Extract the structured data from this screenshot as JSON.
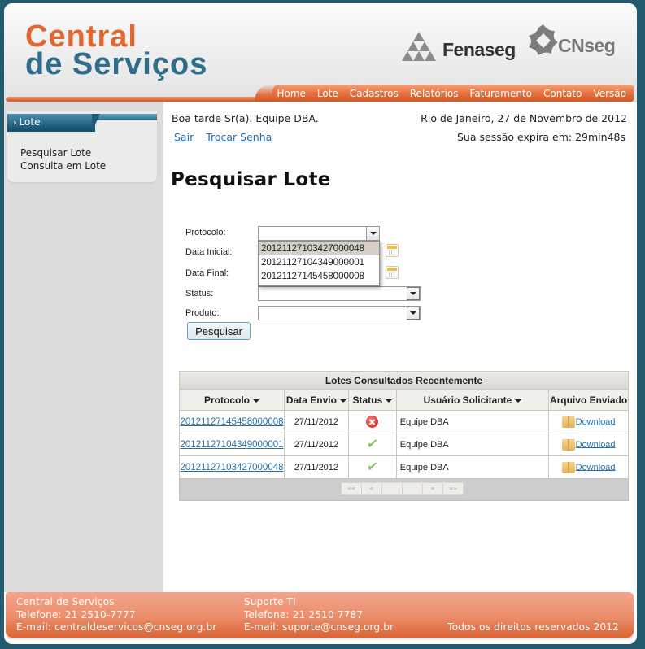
{
  "header": {
    "logo_line1": "Central",
    "logo_line2": "de Serviços",
    "partner1": "Fenaseg",
    "partner2": "CNseg",
    "nav": [
      "Home",
      "Lote",
      "Cadastros",
      "Relatórios",
      "Faturamento",
      "Contato",
      "Versão"
    ]
  },
  "sidebar": {
    "section_title": "Lote",
    "items": [
      "Pesquisar Lote",
      "Consulta em Lote"
    ]
  },
  "user": {
    "greeting": "Boa tarde Sr(a). Equipe DBA.",
    "date": "Rio de Janeiro, 27 de Novembro de 2012",
    "logout": "Sair",
    "change_password": "Trocar Senha",
    "session": "Sua sessão expira em: 29min48s"
  },
  "page": {
    "title": "Pesquisar Lote"
  },
  "form": {
    "protocolo_label": "Protocolo:",
    "protocolo_value": "",
    "protocolo_options": [
      "20121127103427000048",
      "20121127104349000001",
      "20121127145458000008"
    ],
    "data_inicial_label": "Data Inicial:",
    "data_final_label": "Data Final:",
    "status_label": "Status:",
    "status_value": "",
    "produto_label": "Produto:",
    "produto_value": "",
    "search_button": "Pesquisar"
  },
  "table": {
    "title": "Lotes Consultados Recentemente",
    "columns": [
      "Protocolo",
      "Data Envio",
      "Status",
      "Usuário Solicitante",
      "Arquivo Enviado"
    ],
    "rows": [
      {
        "protocolo": "20121127145458000008",
        "data_envio": "27/11/2012",
        "status": "error",
        "usuario": "Equipe DBA",
        "arquivo": "Download"
      },
      {
        "protocolo": "20121127104349000001",
        "data_envio": "27/11/2012",
        "status": "success",
        "usuario": "Equipe DBA",
        "arquivo": "Download"
      },
      {
        "protocolo": "20121127103427000048",
        "data_envio": "27/11/2012",
        "status": "success",
        "usuario": "Equipe DBA",
        "arquivo": "Download"
      }
    ],
    "pager": [
      "««",
      "«",
      "",
      "",
      "»",
      "»»"
    ]
  },
  "footer": {
    "col1": [
      "Central de Serviços",
      "Telefone: 21 2510-7777",
      "E-mail: centraldeservicos@cnseg.org.br"
    ],
    "col2": [
      "Suporte TI",
      "Telefone: 21 2510 7787",
      "E-mail: suporte@cnseg.org.br"
    ],
    "copyright": "Todos os direitos reservados 2012"
  },
  "colors": {
    "brand_orange": "#e0672f",
    "brand_blue": "#2f6d8a",
    "link": "#2a6ea6",
    "frame_bg": "#235a6e"
  }
}
